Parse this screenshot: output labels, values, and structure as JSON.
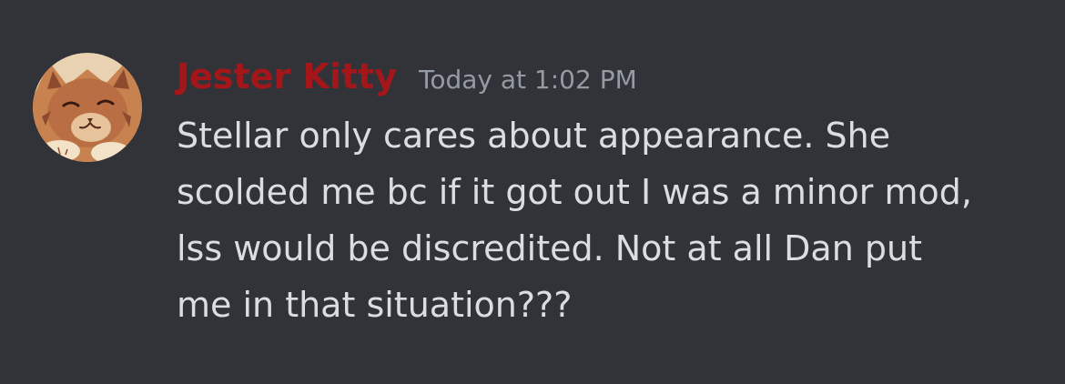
{
  "message": {
    "author": {
      "name": "Jester Kitty",
      "name_color": "#a3171b"
    },
    "timestamp": "Today at 1:02 PM",
    "content": "Stellar only cares about appearance. She\nscolded me bc if it got out I was a minor mod,\nlss would be discredited. Not at all Dan put\nme in that situation???"
  },
  "colors": {
    "background": "#313338",
    "text": "#dbdee1",
    "muted": "#949ba4"
  }
}
